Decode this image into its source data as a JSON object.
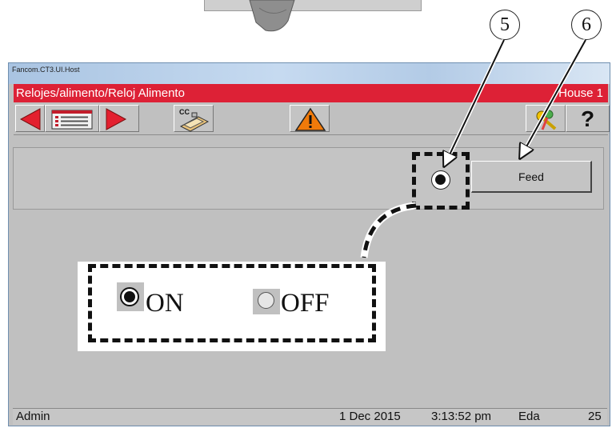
{
  "window": {
    "app_title": "Fancom.CT3.UI.Host",
    "breadcrumb": "Relojes/alimento/Reloj Alimento",
    "house": "House 1"
  },
  "toolbar": {
    "prev_icon": "arrow-left-icon",
    "list_icon": "list-icon",
    "next_icon": "arrow-right-icon",
    "cc_icon": "control-computer-icon",
    "cc_label": "CC",
    "warning_icon": "warning-icon",
    "key_icon": "key-icon",
    "help_label": "?"
  },
  "main": {
    "feed_label": "Feed",
    "radio_state": "on"
  },
  "callouts": {
    "n5": "5",
    "n6": "6"
  },
  "zoom": {
    "on_label": "ON",
    "off_label": "OFF",
    "on_selected": true,
    "off_selected": false
  },
  "status": {
    "user": "Admin",
    "date": "1 Dec 2015",
    "time": "3:13:52 pm",
    "lang": "Eda",
    "number": "25"
  },
  "colors": {
    "red_bar": "#dd2136",
    "panel_bg": "#c0c0c0",
    "arrow_red": "#e3202f",
    "warning_orange": "#f07a0a"
  }
}
